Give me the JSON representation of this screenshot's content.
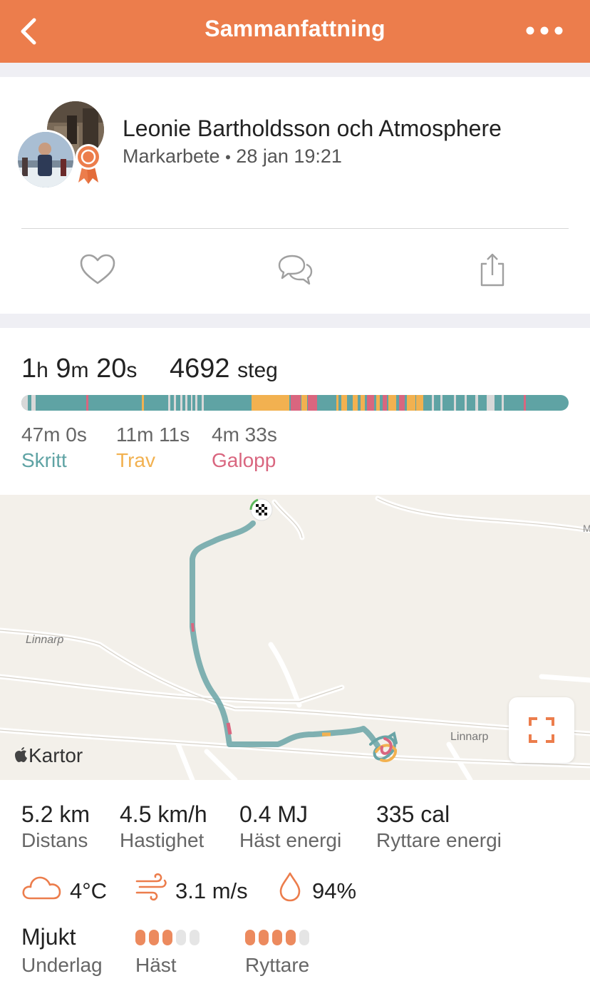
{
  "nav": {
    "title": "Sammanfattning"
  },
  "post": {
    "title": "Leonie Bartholdsson och Atmosphere",
    "activity": "Markarbete",
    "separator": "•",
    "datetime": "28 jan 19:21"
  },
  "summary": {
    "hours": "1",
    "hours_unit": "h",
    "minutes": "9",
    "minutes_unit": "m",
    "seconds": "20",
    "seconds_unit": "s",
    "steps": "4692",
    "steps_unit": "steg"
  },
  "gaits": [
    {
      "time": "47m 0s",
      "label": "Skritt",
      "color": "#5fa3a4"
    },
    {
      "time": "11m 11s",
      "label": "Trav",
      "color": "#f2b150"
    },
    {
      "time": "4m 33s",
      "label": "Galopp",
      "color": "#d9667f"
    }
  ],
  "map": {
    "brand": "Kartor",
    "place_left": "Linnarp",
    "place_right": "Linnarp",
    "edge_label": "M"
  },
  "stats": [
    {
      "value": "5.2 km",
      "label": "Distans"
    },
    {
      "value": "4.5 km/h",
      "label": "Hastighet"
    },
    {
      "value": "0.4 MJ",
      "label": "Häst energi"
    },
    {
      "value": "335 cal",
      "label": "Ryttare energi"
    }
  ],
  "weather": {
    "temperature": "4°C",
    "wind": "3.1 m/s",
    "humidity": "94%"
  },
  "surface": {
    "value": "Mjukt",
    "label": "Underlag",
    "horse_label": "Häst",
    "horse_level": 3,
    "rider_label": "Ryttare",
    "rider_level": 4,
    "max_level": 5
  },
  "colors": {
    "accent": "#ec7d4c",
    "walk": "#5fa3a4",
    "trot": "#f2b150",
    "gallop": "#d9667f"
  }
}
